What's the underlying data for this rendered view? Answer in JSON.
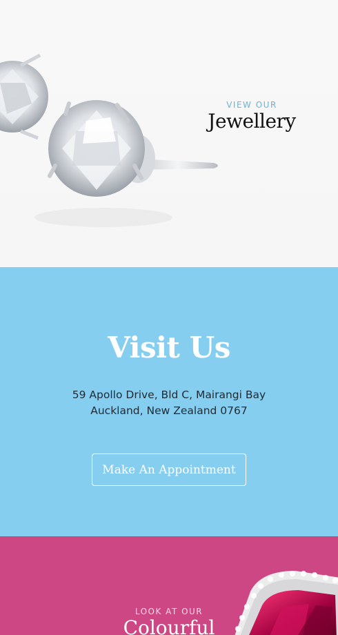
{
  "jewellery": {
    "eyebrow": "VIEW OUR",
    "heading": "Jewellery"
  },
  "visit": {
    "title": "Visit Us",
    "address_line1": "59 Apollo Drive, Bld C, Mairangi Bay",
    "address_line2": "Auckland, New Zealand 0767",
    "button_label": "Make An Appointment"
  },
  "colourful": {
    "eyebrow": "LOOK AT OUR",
    "heading": "Colourful"
  },
  "colors": {
    "visit_bg": "#86cef0",
    "colourful_bg": "#cc4783",
    "eyebrow_blue": "#6ab2d6"
  }
}
